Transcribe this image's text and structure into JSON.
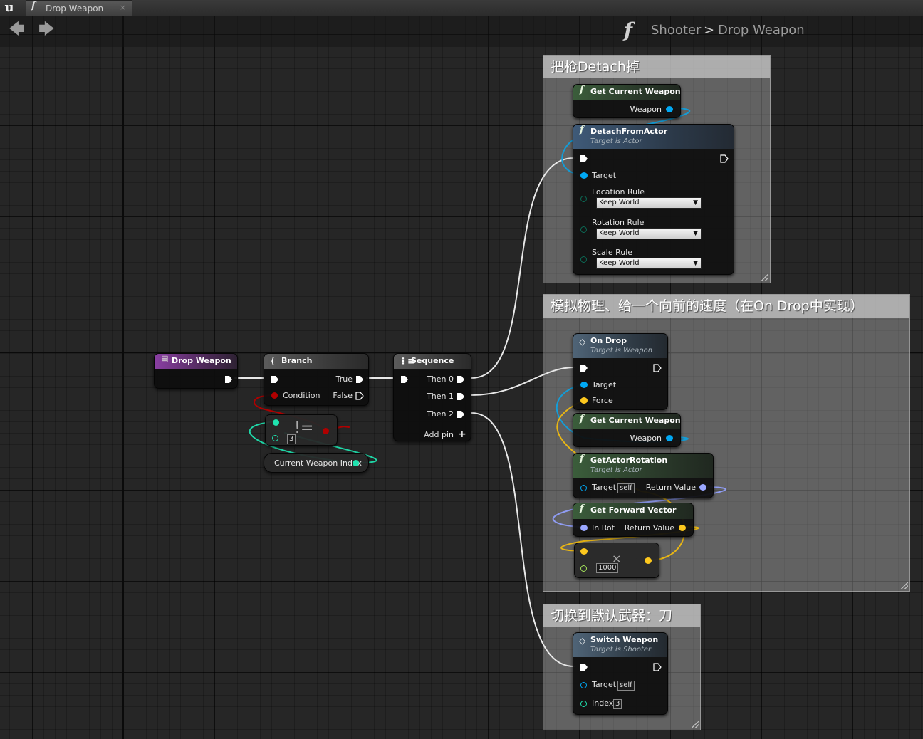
{
  "tab": {
    "label": "Drop Weapon",
    "close": "×"
  },
  "breadcrumb": {
    "icon": "function-icon",
    "root": "Shooter",
    "sep": ">",
    "current": "Drop Weapon"
  },
  "comments": {
    "detach": "把枪Detach掉",
    "physics": "模拟物理、给一个向前的速度（在On Drop中实现）",
    "switch": "切换到默认武器：刀"
  },
  "nodes": {
    "entry": {
      "title": "Drop Weapon"
    },
    "branch": {
      "title": "Branch",
      "true": "True",
      "false": "False",
      "condition": "Condition"
    },
    "notequal": {
      "op": "!=",
      "value": "3"
    },
    "cwi": {
      "title": "Current Weapon Index"
    },
    "sequence": {
      "title": "Sequence",
      "then0": "Then 0",
      "then1": "Then 1",
      "then2": "Then 2",
      "add": "Add pin"
    },
    "gcw1": {
      "title": "Get Current Weapon",
      "out": "Weapon"
    },
    "detach": {
      "title": "DetachFromActor",
      "sub": "Target is Actor",
      "target": "Target",
      "loc": "Location Rule",
      "rot": "Rotation Rule",
      "scale": "Scale Rule",
      "loc_val": "Keep World",
      "rot_val": "Keep World",
      "scale_val": "Keep World"
    },
    "ondrop": {
      "title": "On Drop",
      "sub": "Target is Weapon",
      "target": "Target",
      "force": "Force"
    },
    "gcw2": {
      "title": "Get Current Weapon",
      "out": "Weapon"
    },
    "getrot": {
      "title": "GetActorRotation",
      "sub": "Target is Actor",
      "target": "Target",
      "self": "self",
      "ret": "Return Value"
    },
    "fwd": {
      "title": "Get Forward Vector",
      "inrot": "In Rot",
      "ret": "Return Value"
    },
    "mult": {
      "op": "×",
      "value": "1000"
    },
    "switch": {
      "title": "Switch Weapon",
      "sub": "Target is Shooter",
      "target": "Target",
      "self": "self",
      "index": "Index",
      "index_val": "3"
    }
  },
  "colors": {
    "exec": "#ffffff",
    "object": "#00a8f4",
    "bool": "#920000",
    "int": "#1fe3af",
    "rotator": "#9aa7ff",
    "vector": "#fdc81e"
  }
}
